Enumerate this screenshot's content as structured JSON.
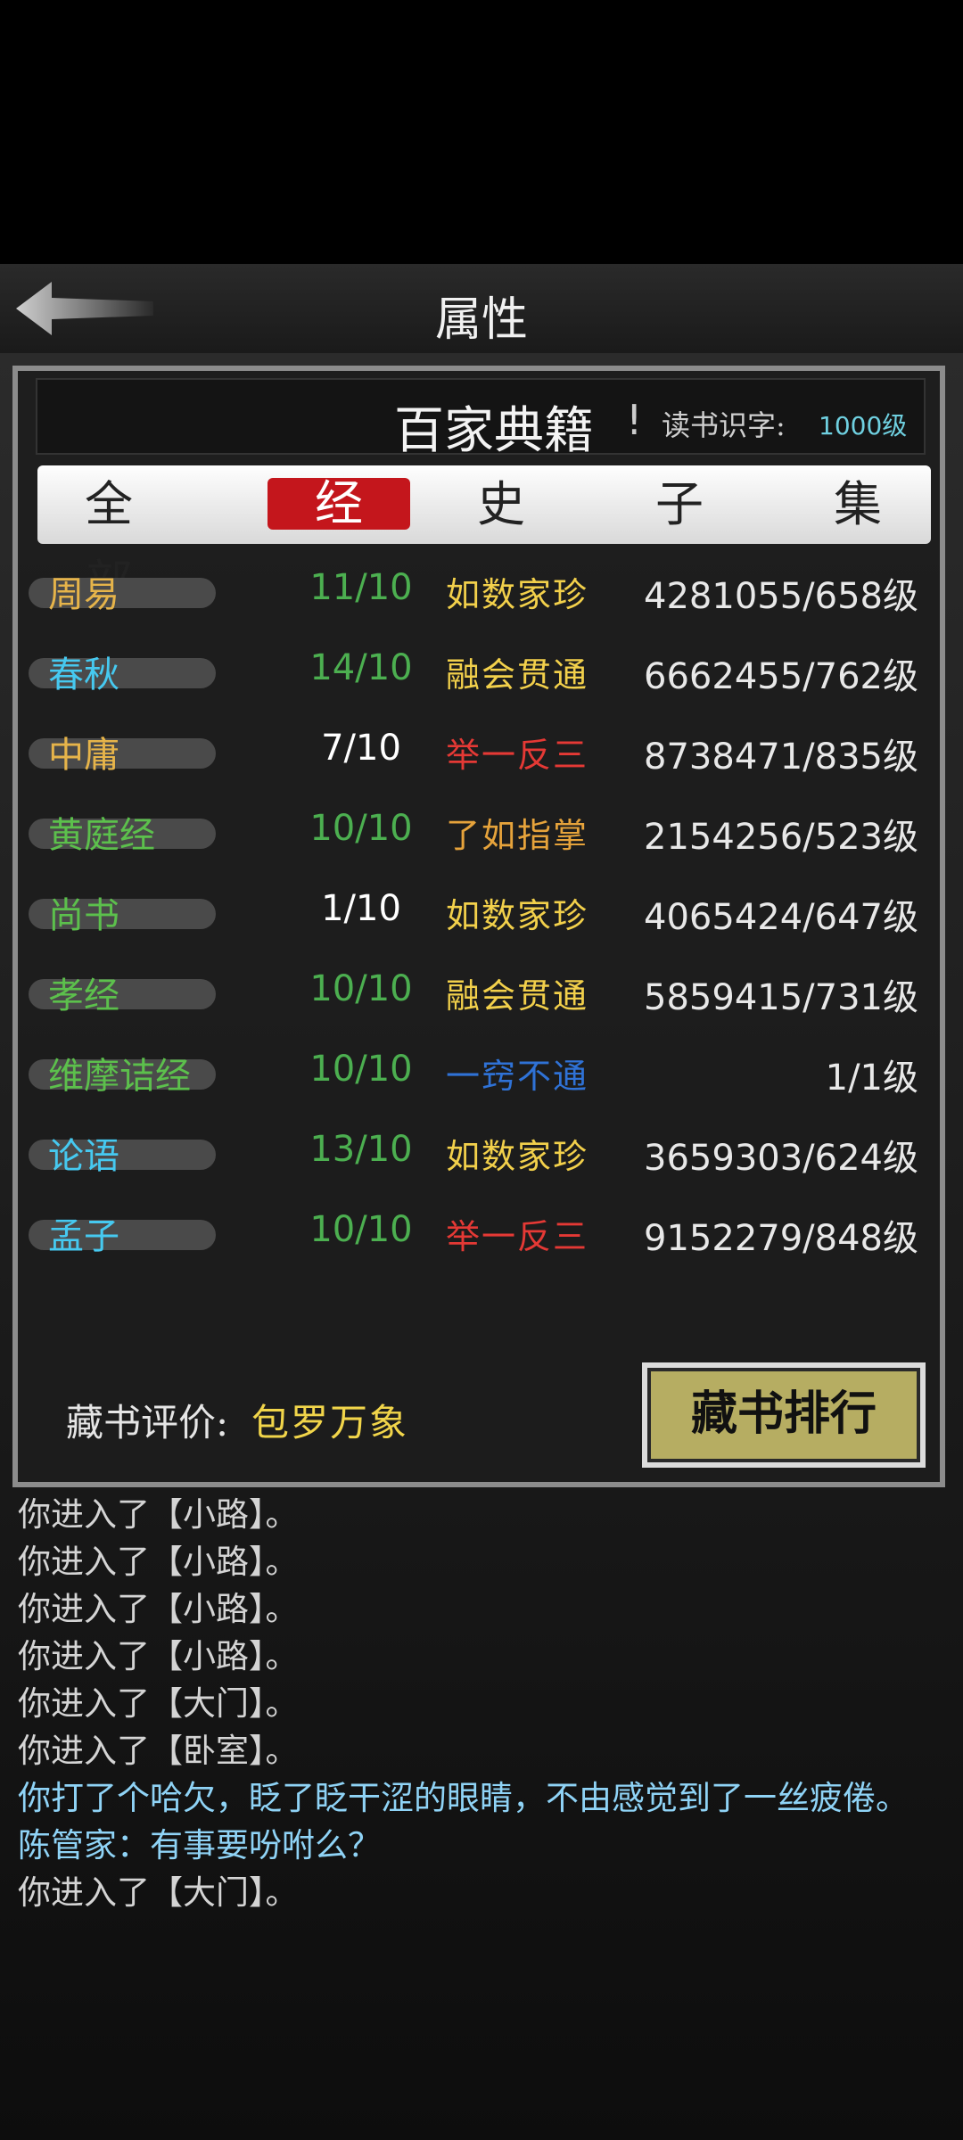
{
  "header": {
    "title": "属性"
  },
  "dialog": {
    "title": "百家典籍",
    "exclaim": "!",
    "reading_label": "读书识字:",
    "reading_value": "1000级",
    "tabs": [
      {
        "label": "全  部",
        "active": false
      },
      {
        "label": "经",
        "active": true
      },
      {
        "label": "史",
        "active": false
      },
      {
        "label": "子",
        "active": false
      },
      {
        "label": "集",
        "active": false
      }
    ],
    "books": [
      {
        "name": "周易",
        "name_color": "#e6b44a",
        "score": "11/10",
        "score_color": "#4caf50",
        "grade": "如数家珍",
        "grade_color": "#f2d04b",
        "progress": "4281055/658级"
      },
      {
        "name": "春秋",
        "name_color": "#46c9f0",
        "score": "14/10",
        "score_color": "#4caf50",
        "grade": "融会贯通",
        "grade_color": "#f2d04b",
        "progress": "6662455/762级"
      },
      {
        "name": "中庸",
        "name_color": "#e6b44a",
        "score": "7/10",
        "score_color": "#ffffff",
        "grade": "举一反三",
        "grade_color": "#e53935",
        "progress": "8738471/835级"
      },
      {
        "name": "黄庭经",
        "name_color": "#5cc04c",
        "score": "10/10",
        "score_color": "#4caf50",
        "grade": "了如指掌",
        "grade_color": "#e6a33b",
        "progress": "2154256/523级"
      },
      {
        "name": "尚书",
        "name_color": "#5cc04c",
        "score": "1/10",
        "score_color": "#ffffff",
        "grade": "如数家珍",
        "grade_color": "#f2d04b",
        "progress": "4065424/647级"
      },
      {
        "name": "孝经",
        "name_color": "#5cc04c",
        "score": "10/10",
        "score_color": "#4caf50",
        "grade": "融会贯通",
        "grade_color": "#f2d04b",
        "progress": "5859415/731级"
      },
      {
        "name": "维摩诘经",
        "name_color": "#5cc04c",
        "score": "10/10",
        "score_color": "#4caf50",
        "grade": "一窍不通",
        "grade_color": "#2f72d6",
        "progress": "1/1级"
      },
      {
        "name": "论语",
        "name_color": "#46c9f0",
        "score": "13/10",
        "score_color": "#4caf50",
        "grade": "如数家珍",
        "grade_color": "#f2d04b",
        "progress": "3659303/624级"
      },
      {
        "name": "孟子",
        "name_color": "#46c9f0",
        "score": "10/10",
        "score_color": "#4caf50",
        "grade": "举一反三",
        "grade_color": "#e53935",
        "progress": "9152279/848级"
      }
    ],
    "evaluation_label": "藏书评价:",
    "evaluation_value": "包罗万象",
    "rank_button": "藏书排行"
  },
  "log": [
    {
      "text": "你进入了【小路】。",
      "color": "white"
    },
    {
      "text": "你进入了【小路】。",
      "color": "white"
    },
    {
      "text": "你进入了【小路】。",
      "color": "white"
    },
    {
      "text": "你进入了【小路】。",
      "color": "white"
    },
    {
      "text": "你进入了【大门】。",
      "color": "white"
    },
    {
      "text": "你进入了【卧室】。",
      "color": "white"
    },
    {
      "text": "你打了个哈欠，眨了眨干涩的眼睛，不由感觉到了一丝疲倦。",
      "color": "cyan"
    },
    {
      "text": "陈管家：有事要吩咐么？",
      "color": "cyan"
    },
    {
      "text": "你进入了【大门】。",
      "color": "white"
    }
  ]
}
